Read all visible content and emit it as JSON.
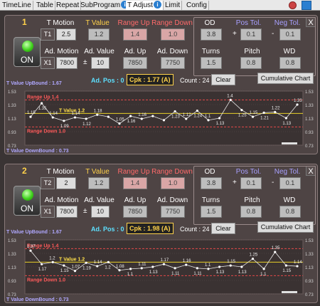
{
  "tabs": [
    {
      "label": "TimeLine"
    },
    {
      "label": "Table"
    },
    {
      "label": "Repeat"
    },
    {
      "label": "SubProgram"
    },
    {
      "label": "T Adjust"
    },
    {
      "label": "Limit"
    },
    {
      "label": "Config"
    }
  ],
  "panels": [
    {
      "number": "1",
      "on_label": "ON",
      "close": "X",
      "headers": {
        "t_motion": "T Motion",
        "t_value": "T Value",
        "range_up": "Range Up",
        "range_down": "Range Down",
        "ad_motion": "Ad. Motion",
        "ad_value": "Ad. Value",
        "ad_up": "Ad. Up",
        "ad_down": "Ad. Down",
        "od": "OD",
        "pos_tol": "Pos Tol.",
        "neg_tol": "Neg Tol.",
        "turns": "Turns",
        "pitch": "Pitch",
        "wd": "WD"
      },
      "t_tag": "T1",
      "t_motion": "2.5",
      "t_value": "1.2",
      "range_up": "1.4",
      "range_down": "1.0",
      "x_tag": "X1",
      "ad_motion": "7800",
      "pm": "±",
      "ad_value": "10",
      "ad_up": "7850",
      "ad_down": "7750",
      "od": "3.8",
      "plus": "+",
      "pos_tol": "0.1",
      "minus": "-",
      "neg_tol": "0.1",
      "turns": "1.5",
      "pitch": "0.8",
      "wd": "0.8",
      "ad_pos": "Ad. Pos : 0",
      "cpk": "Cpk : 1.77",
      "cpk_grade": "(A)",
      "count": "Count : 24",
      "clear": "Clear",
      "cumulative": "Cumulative Chart",
      "upbound": "T Value UpBound : 1.67",
      "downbound": "T Value DownBound : 0.73",
      "chart_data": {
        "type": "line",
        "yticks": [
          "1.53",
          "1.33",
          "1.13",
          "0.93",
          "0.73"
        ],
        "ylim": [
          0.73,
          1.53
        ],
        "range_up_label": "Range Up 1.4",
        "t_value_label": "T Value 1.2",
        "range_down_label": "Range Down 1.0",
        "range_up": 1.4,
        "t_value": 1.2,
        "range_down": 1.0,
        "values": [
          1.15,
          1.35,
          1.14,
          1.09,
          1.14,
          1.12,
          1.18,
          1.15,
          1.05,
          1.16,
          1.12,
          1.16,
          1.1,
          1.23,
          1.12,
          1.24,
          1.1,
          1.13,
          1.4,
          1.25,
          1.15,
          1.21,
          1.22,
          1.13,
          1.33
        ],
        "labels": [
          "1.15",
          "1.35",
          "1.14",
          "1.09",
          "1.14",
          "1.12",
          "1.18",
          "",
          "1.05",
          "1.16",
          "1.16",
          "",
          "",
          "1.23",
          "1.12",
          "1.24",
          "1.1",
          "1.13",
          "1.4",
          "1.25",
          "1.15",
          "1.21",
          "1.22",
          "1.13",
          "1.33"
        ]
      }
    },
    {
      "number": "2",
      "on_label": "ON",
      "close": "X",
      "headers": {
        "t_motion": "T Motion",
        "t_value": "T Value",
        "range_up": "Range Up",
        "range_down": "Range Down",
        "ad_motion": "Ad. Motion",
        "ad_value": "Ad. Value",
        "ad_up": "Ad. Up",
        "ad_down": "Ad. Down",
        "od": "OD",
        "pos_tol": "Pos Tol.",
        "neg_tol": "Neg Tol.",
        "turns": "Turns",
        "pitch": "Pitch",
        "wd": "WD"
      },
      "t_tag": "T2",
      "t_motion": "2",
      "t_value": "1.2",
      "range_up": "1.4",
      "range_down": "1.0",
      "x_tag": "X1",
      "ad_motion": "7800",
      "pm": "±",
      "ad_value": "10",
      "ad_up": "7850",
      "ad_down": "7750",
      "od": "3.8",
      "plus": "+",
      "pos_tol": "0.1",
      "minus": "-",
      "neg_tol": "0.1",
      "turns": "1.5",
      "pitch": "0.8",
      "wd": "0.8",
      "ad_pos": "Ad. Pos : 0",
      "cpk": "Cpk : 1.98",
      "cpk_grade": "(A)",
      "count": "Count : 24",
      "clear": "Clear",
      "cumulative": "Cumulative Chart",
      "upbound": "T Value UpBound : 1.67",
      "downbound": "T Value DownBound : 0.73",
      "chart_data": {
        "type": "line",
        "yticks": [
          "1.53",
          "1.33",
          "1.13",
          "0.93",
          "0.73"
        ],
        "ylim": [
          0.73,
          1.53
        ],
        "range_up_label": "Range Up 1.4",
        "t_value_label": "T Value 1.2",
        "range_down_label": "Range Down 1.0",
        "range_up": 1.4,
        "t_value": 1.2,
        "range_down": 1.0,
        "values": [
          1.37,
          1.17,
          1.2,
          1.15,
          1.07,
          1.19,
          1.14,
          1.2,
          1.08,
          1.1,
          1.11,
          1.13,
          1.17,
          1.11,
          1.16,
          1.11,
          1.1,
          1.13,
          1.15,
          1.13,
          1.25,
          1.1,
          1.35,
          1.15,
          1.14
        ],
        "labels": [
          "1.37",
          "1.17",
          "1.2",
          "1.15",
          "1.07",
          "1.19",
          "1.14",
          "1.2",
          "1.08",
          "1.1",
          "1.11",
          "1.13",
          "1.17",
          "1.11",
          "1.16",
          "1.11",
          "1.1",
          "1.13",
          "1.15",
          "1.13",
          "1.25",
          "1.1",
          "1.35",
          "1.15",
          "1.14"
        ]
      }
    }
  ]
}
